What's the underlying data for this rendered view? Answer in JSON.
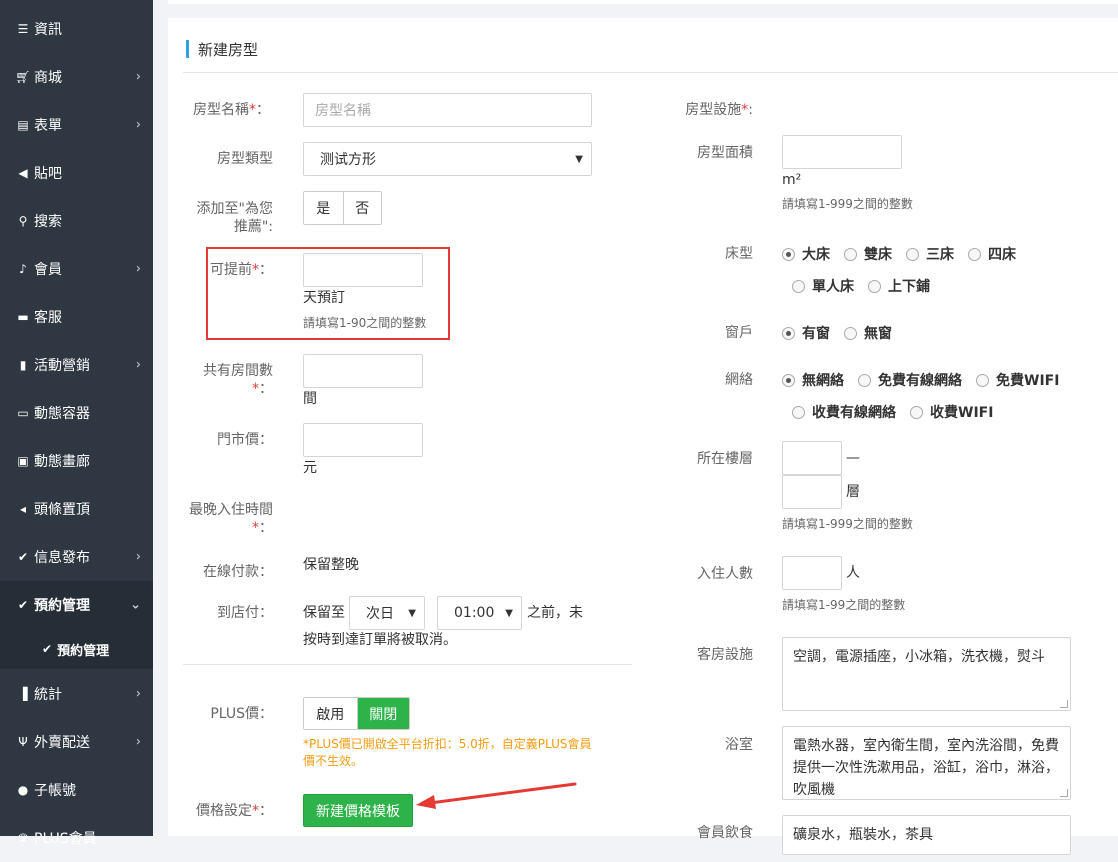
{
  "sidebar": {
    "items": [
      {
        "label": "資訊",
        "icon": "list-icon",
        "chevron": false
      },
      {
        "label": "商城",
        "icon": "cart-icon",
        "chevron": true
      },
      {
        "label": "表單",
        "icon": "form-icon",
        "chevron": true
      },
      {
        "label": "貼吧",
        "icon": "megaphone-icon",
        "chevron": false
      },
      {
        "label": "搜索",
        "icon": "search-icon",
        "chevron": false
      },
      {
        "label": "會員",
        "icon": "bell-icon",
        "chevron": true
      },
      {
        "label": "客服",
        "icon": "chat-icon",
        "chevron": false
      },
      {
        "label": "活動營銷",
        "icon": "bookmark-icon",
        "chevron": true
      },
      {
        "label": "動態容器",
        "icon": "container-icon",
        "chevron": false
      },
      {
        "label": "動態畫廊",
        "icon": "image-icon",
        "chevron": false
      },
      {
        "label": "頭條置頂",
        "icon": "volume-icon",
        "chevron": false
      },
      {
        "label": "信息發布",
        "icon": "check-edit-icon",
        "chevron": true
      },
      {
        "label": "預約管理",
        "icon": "check-edit-icon",
        "chevron": true,
        "active": true
      },
      {
        "label": "統計",
        "icon": "bar-chart-icon",
        "chevron": true
      },
      {
        "label": "外賣配送",
        "icon": "cutlery-icon",
        "chevron": true
      },
      {
        "label": "子帳號",
        "icon": "user-icon",
        "chevron": false
      },
      {
        "label": "PLUS會員",
        "icon": "plus-member-icon",
        "chevron": false
      }
    ],
    "sub_item": "預約管理"
  },
  "page": {
    "title": "新建房型"
  },
  "left": {
    "room_name_label": "房型名稱",
    "room_name_placeholder": "房型名稱",
    "room_type_label": "房型類型",
    "room_type_value": "测试方形",
    "recommend_label_1": "添加至\"為您",
    "recommend_label_2": "推薦\":",
    "recommend_yes": "是",
    "recommend_no": "否",
    "advance_label": "可提前",
    "advance_unit": "天預訂",
    "advance_hint": "請填寫1-90之間的整數",
    "rooms_label": "共有房間數",
    "rooms_unit": "間",
    "price_label": "門市價：",
    "price_unit": "元",
    "latest_checkin_label": "最晚入住時間",
    "online_pay_label": "在線付款：",
    "online_pay_value": "保留整晚",
    "store_pay_label": "到店付：",
    "store_pay_prefix": "保留至",
    "store_pay_day": "次日",
    "store_pay_time": "01:00",
    "store_pay_suffix": "之前，未",
    "store_pay_line2": "按時到達訂單將被取消。",
    "plus_label": "PLUS價：",
    "plus_enable": "啟用",
    "plus_disable": "關閉",
    "plus_warning": "*PLUS價已開啟全平台折扣：5.0折，自定義PLUS會員價不生效。",
    "price_setting_label": "價格設定",
    "new_template_button": "新建價格模板"
  },
  "right": {
    "facilities_label": "房型設施",
    "area_label": "房型面積",
    "area_unit": "m²",
    "area_hint": "請填寫1-999之間的整數",
    "bed_label": "床型",
    "bed_options": [
      "大床",
      "雙床",
      "三床",
      "四床",
      "單人床",
      "上下鋪"
    ],
    "window_label": "窗戶",
    "window_options": [
      "有窗",
      "無窗"
    ],
    "network_label": "網絡",
    "network_options": [
      "無網絡",
      "免費有線網絡",
      "免費WIFI",
      "收費有線網絡",
      "收費WIFI"
    ],
    "floor_label": "所在樓層",
    "floor_dash": "—",
    "floor_unit": "層",
    "floor_hint": "請填寫1-999之間的整數",
    "occupancy_label": "入住人數",
    "occupancy_unit": "人",
    "occupancy_hint": "請填寫1-99之間的整數",
    "room_facilities_label": "客房設施",
    "room_facilities_value": "空調，電源插座，小冰箱，洗衣機，熨斗",
    "bathroom_label": "浴室",
    "bathroom_value": "電熱水器，室內衛生間，室內洗浴間，免費提供一次性洗漱用品，浴缸，浴巾，淋浴，吹風機",
    "food_label": "會員飲食",
    "food_value": "礦泉水，瓶裝水，茶具"
  },
  "colors": {
    "sidebar_bg": "#2f3743",
    "accent_green": "#2db34a",
    "title_bar": "#2ea2e6",
    "highlight_red": "#e53935",
    "warning": "#f39c12"
  }
}
